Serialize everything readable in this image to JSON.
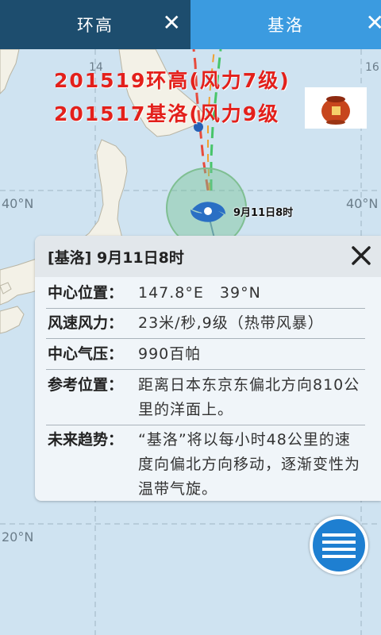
{
  "tabs": [
    {
      "label": "环高",
      "close": "✕"
    },
    {
      "label": "基洛",
      "close": "✕"
    }
  ],
  "map": {
    "lat_labels": [
      "40°N",
      "40°N",
      "20°N"
    ],
    "lon_labels": [
      "14",
      "16"
    ],
    "track_label": "9月11日8时"
  },
  "overlay": {
    "line1": "201519环高(风力7级)",
    "line2": "201517基洛(风力9级"
  },
  "card": {
    "title": "[基洛] 9月11日8时",
    "rows": [
      {
        "key": "中心位置：",
        "value": "147.8°E　39°N"
      },
      {
        "key": "风速风力：",
        "value": "23米/秒,9级（热带风暴）"
      },
      {
        "key": "中心气压：",
        "value": "990百帕"
      },
      {
        "key": "参考位置：",
        "value": "距离日本东京东偏北方向810公里的洋面上。"
      },
      {
        "key": "未来趋势：",
        "value": "“基洛”将以每小时48公里的速度向偏北方向移动，逐渐变性为温带气旋。"
      }
    ]
  },
  "colors": {
    "tab_inactive": "#1d4d6e",
    "tab_active": "#3b9be0",
    "title_red": "#e3201b",
    "menu_blue": "#1e7fd1"
  }
}
